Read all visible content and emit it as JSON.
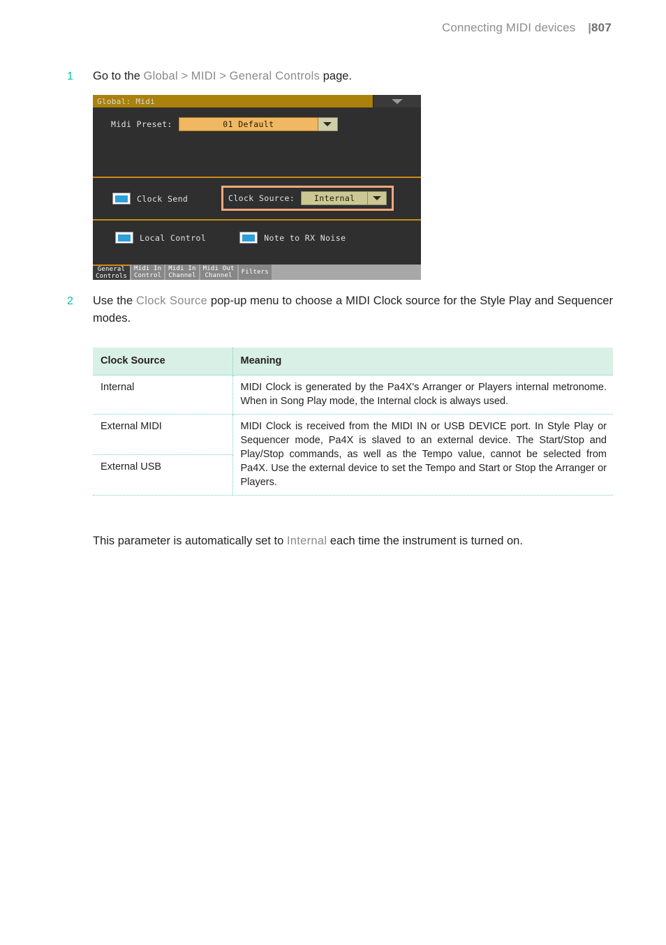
{
  "header": {
    "title": "Connecting MIDI devices",
    "separator": "|",
    "page_number": "807"
  },
  "steps": [
    {
      "number": "1",
      "text_before": "Go to the ",
      "term1": "Global",
      "chevron1": " > ",
      "term2": "MIDI",
      "chevron2": " > ",
      "term3": "General Controls",
      "text_after": " page."
    },
    {
      "number": "2",
      "text_before": "Use the ",
      "term": "Clock Source",
      "text_after": " pop-up menu to choose a MIDI Clock source for the Style Play and Sequencer modes."
    }
  ],
  "lcd": {
    "title": "Global: Midi",
    "collapse_icon": "chevron-down-icon",
    "preset": {
      "label": "Midi Preset:",
      "value": "01 Default",
      "dropdown_icon": "chevron-down-icon"
    },
    "clock_send": {
      "label": "Clock Send",
      "checked": true
    },
    "clock_source": {
      "label": "Clock Source:",
      "value": "Internal",
      "dropdown_icon": "chevron-down-icon",
      "highlight_color": "#f6a97c"
    },
    "local_control": {
      "label": "Local Control",
      "checked": true
    },
    "note_to_rx_noise": {
      "label": "Note to RX Noise",
      "checked": true
    },
    "tabs": [
      {
        "line1": "General",
        "line2": "Controls",
        "active": true
      },
      {
        "line1": "Midi In",
        "line2": "Control",
        "active": false
      },
      {
        "line1": "Midi In",
        "line2": "Channel",
        "active": false
      },
      {
        "line1": "Midi Out",
        "line2": "Channel",
        "active": false
      },
      {
        "line1": "Filters",
        "line2": "",
        "active": false
      }
    ],
    "colors": {
      "titlebar": "#a9810b",
      "background": "#2f2f2f",
      "divider": "#c98a16",
      "checkbox_fill": "#2e9fd9",
      "preset_field": "#f0b862",
      "source_field": "#ccc894"
    }
  },
  "table": {
    "headers": [
      "Clock Source",
      "Meaning"
    ],
    "rows": [
      {
        "source": "Internal",
        "meaning": "MIDI Clock is generated by the Pa4X's Arranger or Players internal metronome. When in Song Play mode, the Internal clock is always used."
      },
      {
        "source": "External MIDI",
        "meaning": "MIDI Clock is received from the MIDI IN or USB DEVICE port. In Style Play or Sequencer mode, Pa4X is slaved to an external device. The Start/Stop and Play/Stop commands, as well as the Tempo value, cannot be selected from Pa4X. Use the external device to set the Tempo and Start or Stop the Arranger or Players."
      },
      {
        "source": "External USB",
        "meaning": ""
      }
    ]
  },
  "closing": {
    "text_before": "This parameter is automatically set to ",
    "term": "Internal",
    "text_after": " each time the instrument is turned on."
  }
}
